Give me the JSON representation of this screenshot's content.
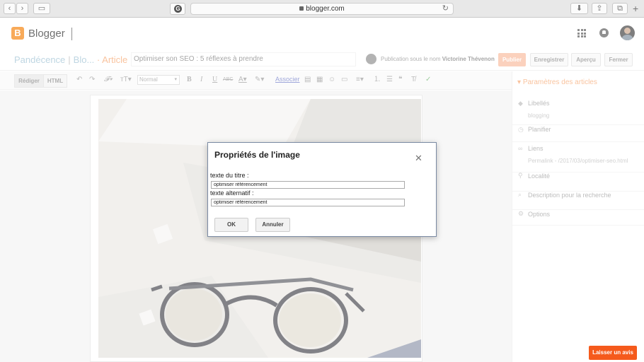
{
  "browser": {
    "url": "blogger.com",
    "tab_icon": "G"
  },
  "app": {
    "name": "Blogger",
    "logo_letter": "B"
  },
  "post_bar": {
    "blog_name": "Pandécence",
    "blog_short": "Blo...",
    "section": "· Article",
    "title_value": "Optimiser son SEO : 5 réflexes à prendre",
    "publish_as_prefix": "Publication sous le nom",
    "publish_as_name": "Victorine Thévenon",
    "publish_label": "Publier",
    "save_label": "Enregistrer",
    "preview_label": "Aperçu",
    "close_label": "Fermer"
  },
  "toolbar": {
    "compose_label": "Rédiger",
    "html_label": "HTML",
    "font_size_value": "Normal",
    "link_label": "Associer"
  },
  "sidebar": {
    "heading": "Paramètres des articles",
    "labels_label": "Libellés",
    "labels_value": "blogging",
    "schedule_label": "Planifier",
    "links_label": "Liens",
    "permalink_value": "Permalink - /2017/03/optimiser-seo.html",
    "location_label": "Localité",
    "search_desc_label": "Description pour la recherche",
    "options_label": "Options"
  },
  "dialog": {
    "title": "Propriétés de l'image",
    "title_field_label": "texte du titre :",
    "title_field_value": "optimiser référencement",
    "alt_field_label": "texte alternatif :",
    "alt_field_value": "optimiser référencement",
    "ok_label": "OK",
    "cancel_label": "Annuler"
  },
  "feedback": {
    "label": "Laisser un avis"
  },
  "colors": {
    "accent": "#f57d00",
    "publish": "#f9b99a",
    "feedback": "#f55a1c",
    "link": "#6a77c7"
  }
}
